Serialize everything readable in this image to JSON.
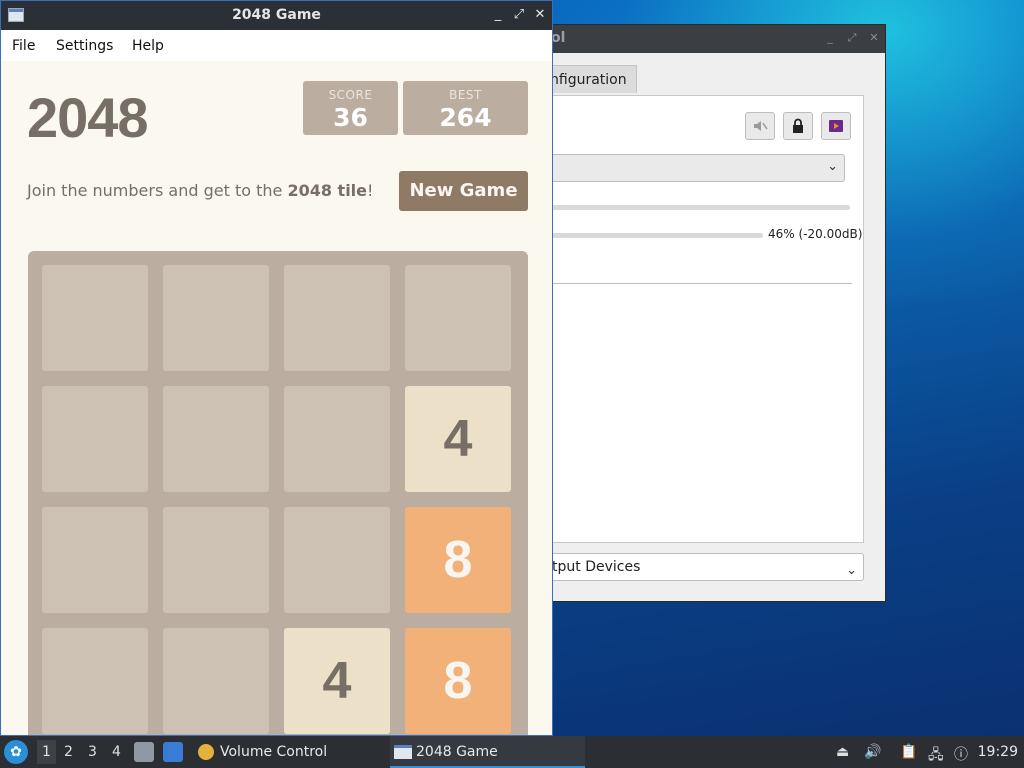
{
  "colors": {
    "game_bg": "#faf8ef",
    "board_bg": "#bbada0",
    "cell_empty": "#cdc1b4",
    "tile_4": "#ede0c8",
    "tile_8": "#f2b179",
    "button_bg": "#8f7a66",
    "text_primary": "#776e65"
  },
  "game_window": {
    "title": "2048 Game",
    "icon": "window-icon",
    "controls": {
      "minimize": "_",
      "maximize": "⤢",
      "close": "✕"
    },
    "menu": [
      "File",
      "Settings",
      "Help"
    ],
    "heading": "2048",
    "score": {
      "label": "SCORE",
      "value": "36"
    },
    "best": {
      "label": "BEST",
      "value": "264"
    },
    "intro": {
      "prefix": "Join the numbers and get to the ",
      "bold": "2048 tile",
      "suffix": "!"
    },
    "new_game_label": "New Game",
    "board": [
      [
        null,
        null,
        null,
        null
      ],
      [
        null,
        null,
        null,
        4
      ],
      [
        null,
        null,
        null,
        8
      ],
      [
        null,
        null,
        4,
        8
      ]
    ]
  },
  "volume_window": {
    "title_fragment": "ol",
    "tab_label": "nfiguration",
    "icons": [
      "mute-icon",
      "lock-icon",
      "default-device-icon"
    ],
    "volume_readout": "46% (-20.00dB)",
    "bottom_combo": "tput Devices"
  },
  "taskbar": {
    "start_icon": "start-menu-icon",
    "workspaces": [
      "1",
      "2",
      "3",
      "4"
    ],
    "active_workspace": "1",
    "quicklaunch": [
      "file-manager-icon",
      "desktop-icon"
    ],
    "tasks": [
      {
        "label": "Volume Control",
        "icon": "speaker-icon",
        "active": false
      },
      {
        "label": "2048 Game",
        "icon": "window-icon",
        "active": true
      }
    ],
    "tray": [
      "eject-icon",
      "volume-icon",
      "clipboard-icon",
      "network-icon",
      "update-icon"
    ],
    "clock": "19:29"
  }
}
